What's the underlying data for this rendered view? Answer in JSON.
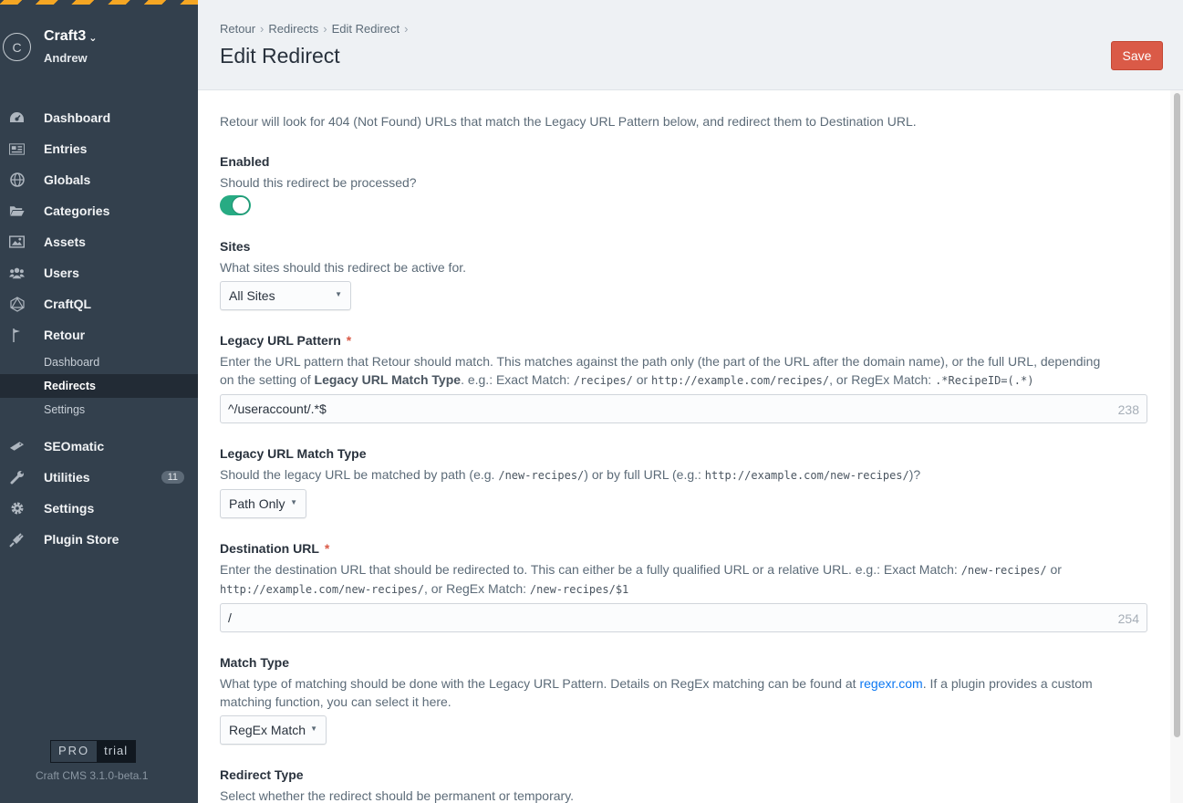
{
  "sidebar": {
    "site_initial": "C",
    "site_name": "Craft3",
    "user_name": "Andrew",
    "nav": [
      {
        "label": "Dashboard",
        "icon": "dashboard-icon"
      },
      {
        "label": "Entries",
        "icon": "entries-icon"
      },
      {
        "label": "Globals",
        "icon": "globe-icon"
      },
      {
        "label": "Categories",
        "icon": "folder-icon"
      },
      {
        "label": "Assets",
        "icon": "image-icon"
      },
      {
        "label": "Users",
        "icon": "users-icon"
      },
      {
        "label": "CraftQL",
        "icon": "graphql-icon"
      },
      {
        "label": "Retour",
        "icon": "flag-icon"
      }
    ],
    "retour_subnav": [
      {
        "label": "Dashboard"
      },
      {
        "label": "Redirects"
      },
      {
        "label": "Settings"
      }
    ],
    "nav_bottom": [
      {
        "label": "SEOmatic",
        "icon": "seomatic-icon"
      },
      {
        "label": "Utilities",
        "icon": "wrench-icon",
        "badge": "11"
      },
      {
        "label": "Settings",
        "icon": "gear-icon"
      },
      {
        "label": "Plugin Store",
        "icon": "plug-icon"
      }
    ],
    "edition": "PRO",
    "edition_status": "trial",
    "version": "Craft CMS 3.1.0-beta.1"
  },
  "header": {
    "breadcrumb": [
      "Retour",
      "Redirects",
      "Edit Redirect"
    ],
    "title": "Edit Redirect",
    "save_label": "Save"
  },
  "form": {
    "intro": "Retour will look for 404 (Not Found) URLs that match the Legacy URL Pattern below, and redirect them to Destination URL.",
    "enabled": {
      "label": "Enabled",
      "instructions": "Should this redirect be processed?",
      "value": true
    },
    "sites": {
      "label": "Sites",
      "instructions": "What sites should this redirect be active for.",
      "value": "All Sites"
    },
    "legacy_url": {
      "label": "Legacy URL Pattern",
      "instructions_1": "Enter the URL pattern that Retour should match. This matches against the path only (the part of the URL after the domain name), or the full URL, depending",
      "instructions_2a": "on the setting of ",
      "instructions_2b": "Legacy URL Match Type",
      "instructions_2c": ". e.g.: Exact Match: ",
      "code_1": "/recipes/",
      "instructions_2d": " or ",
      "code_2": "http://example.com/recipes/",
      "instructions_2e": ", or RegEx Match: ",
      "code_3": ".*RecipeID=(.*)",
      "value": "^/useraccount/.*$",
      "remaining": "238"
    },
    "legacy_match_type": {
      "label": "Legacy URL Match Type",
      "instructions_a": "Should the legacy URL be matched by path (e.g. ",
      "code_1": "/new-recipes/",
      "instructions_b": ") or by full URL (e.g.: ",
      "code_2": "http://example.com/new-recipes/",
      "instructions_c": ")?",
      "value": "Path Only"
    },
    "destination_url": {
      "label": "Destination URL",
      "instructions_1a": "Enter the destination URL that should be redirected to. This can either be a fully qualified URL or a relative URL. e.g.: Exact Match: ",
      "code_1": "/new-recipes/",
      "instructions_1b": " or",
      "code_2": "http://example.com/new-recipes/",
      "instructions_2a": ", or RegEx Match: ",
      "code_3": "/new-recipes/$1",
      "value": "/",
      "remaining": "254"
    },
    "match_type": {
      "label": "Match Type",
      "instructions_1a": "What type of matching should be done with the Legacy URL Pattern. Details on RegEx matching can be found at ",
      "link": "regexr.com",
      "instructions_1b": ". If a plugin provides a custom",
      "instructions_2": "matching function, you can select it here.",
      "value": "RegEx Match"
    },
    "redirect_type": {
      "label": "Redirect Type",
      "instructions": "Select whether the redirect should be permanent or temporary."
    }
  },
  "colors": {
    "sidebar_bg": "#33404d",
    "accent_save": "#da5a47",
    "toggle_on": "#27ab83",
    "link": "#0d78f2"
  }
}
